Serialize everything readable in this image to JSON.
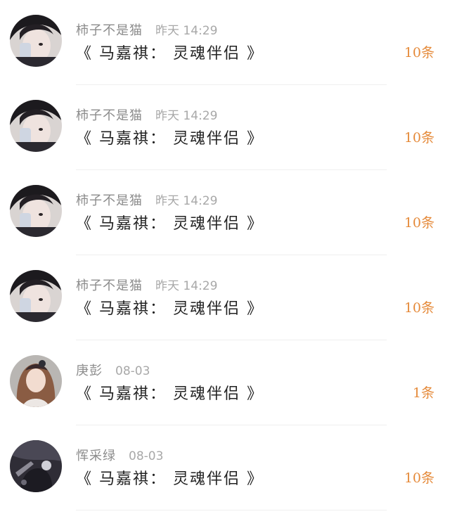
{
  "colors": {
    "accent": "#e58a3a",
    "name": "#8c8c8c",
    "time": "#a8a8a8",
    "title": "#222222"
  },
  "items": [
    {
      "author": "柿子不是猫",
      "time": "昨天 14:29",
      "title": "《 马嘉祺： 灵魂伴侣 》",
      "count": "10条",
      "avatar_icon": "boy-avatar"
    },
    {
      "author": "柿子不是猫",
      "time": "昨天 14:29",
      "title": "《 马嘉祺： 灵魂伴侣 》",
      "count": "10条",
      "avatar_icon": "boy-avatar"
    },
    {
      "author": "柿子不是猫",
      "time": "昨天 14:29",
      "title": "《 马嘉祺： 灵魂伴侣 》",
      "count": "10条",
      "avatar_icon": "boy-avatar"
    },
    {
      "author": "柿子不是猫",
      "time": "昨天 14:29",
      "title": "《 马嘉祺： 灵魂伴侣 》",
      "count": "10条",
      "avatar_icon": "boy-avatar"
    },
    {
      "author": "庚彭",
      "time": "08-03",
      "title": "《 马嘉祺： 灵魂伴侣 》",
      "count": "1条",
      "avatar_icon": "girl-avatar"
    },
    {
      "author": "恽采绿",
      "time": "08-03",
      "title": "《 马嘉祺： 灵魂伴侣 》",
      "count": "10条",
      "avatar_icon": "dark-scene-avatar"
    }
  ]
}
